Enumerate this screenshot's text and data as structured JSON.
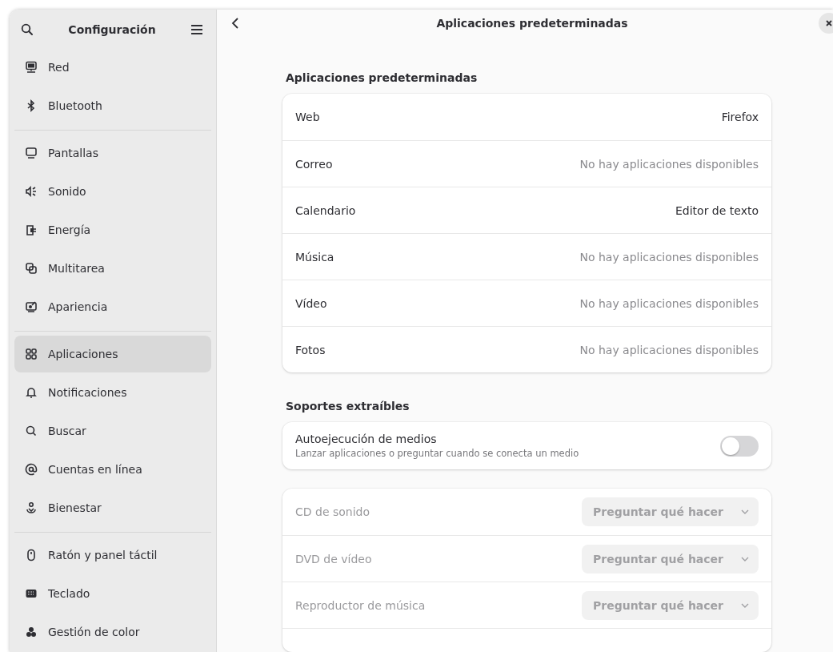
{
  "sidebar": {
    "title": "Configuración",
    "groups": [
      {
        "items": [
          {
            "label": "Red",
            "selected": false
          },
          {
            "label": "Bluetooth",
            "selected": false
          }
        ]
      },
      {
        "items": [
          {
            "label": "Pantallas",
            "selected": false
          },
          {
            "label": "Sonido",
            "selected": false
          },
          {
            "label": "Energía",
            "selected": false
          },
          {
            "label": "Multitarea",
            "selected": false
          },
          {
            "label": "Apariencia",
            "selected": false
          }
        ]
      },
      {
        "items": [
          {
            "label": "Aplicaciones",
            "selected": true
          },
          {
            "label": "Notificaciones",
            "selected": false
          },
          {
            "label": "Buscar",
            "selected": false
          },
          {
            "label": "Cuentas en línea",
            "selected": false
          },
          {
            "label": "Bienestar",
            "selected": false
          }
        ]
      },
      {
        "items": [
          {
            "label": "Ratón y panel táctil",
            "selected": false
          },
          {
            "label": "Teclado",
            "selected": false
          },
          {
            "label": "Gestión de color",
            "selected": false
          }
        ]
      }
    ]
  },
  "page": {
    "title": "Aplicaciones predeterminadas",
    "default_apps": {
      "heading": "Aplicaciones predeterminadas",
      "rows": [
        {
          "label": "Web",
          "value": "Firefox",
          "available": true
        },
        {
          "label": "Correo",
          "value": "No hay aplicaciones disponibles",
          "available": false
        },
        {
          "label": "Calendario",
          "value": "Editor de texto",
          "available": true
        },
        {
          "label": "Música",
          "value": "No hay aplicaciones disponibles",
          "available": false
        },
        {
          "label": "Vídeo",
          "value": "No hay aplicaciones disponibles",
          "available": false
        },
        {
          "label": "Fotos",
          "value": "No hay aplicaciones disponibles",
          "available": false
        }
      ]
    },
    "removable": {
      "heading": "Soportes extraíbles",
      "autorun": {
        "label": "Autoejecución de medios",
        "subtitle": "Lanzar aplicaciones o preguntar cuando se conecta un medio",
        "on": false
      },
      "rows": [
        {
          "label": "CD de sonido",
          "value": "Preguntar qué hacer",
          "disabled": true
        },
        {
          "label": "DVD de vídeo",
          "value": "Preguntar qué hacer",
          "disabled": true
        },
        {
          "label": "Reproductor de música",
          "value": "Preguntar qué hacer",
          "disabled": true
        }
      ]
    }
  }
}
